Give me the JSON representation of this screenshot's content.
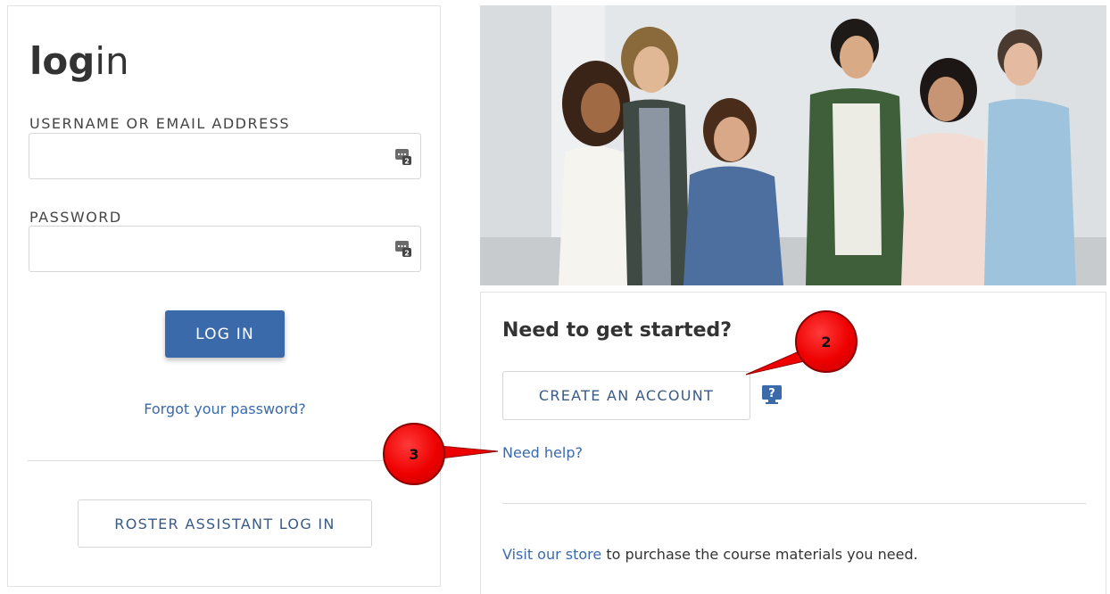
{
  "login": {
    "title_bold": "log",
    "title_rest": "in",
    "username_label": "USERNAME OR EMAIL ADDRESS",
    "username_value": "",
    "password_label": "PASSWORD",
    "password_value": "",
    "login_button": "LOG IN",
    "forgot_link": "Forgot your password?",
    "roster_button": "ROSTER ASSISTANT LOG IN",
    "input_icon": "password-manager-icon"
  },
  "hero": {
    "image": "students-walking-photo"
  },
  "get_started": {
    "heading": "Need to get started?",
    "create_button": "CREATE AN ACCOUNT",
    "help_icon": "help-question-icon",
    "need_help_link": "Need help?",
    "store_link": "Visit our store",
    "store_text": " to purchase the course materials you need."
  },
  "callouts": [
    {
      "label": "2"
    },
    {
      "label": "3"
    }
  ],
  "colors": {
    "primary": "#3b6aab",
    "link": "#3b6aab",
    "callout": "#ee0000"
  }
}
